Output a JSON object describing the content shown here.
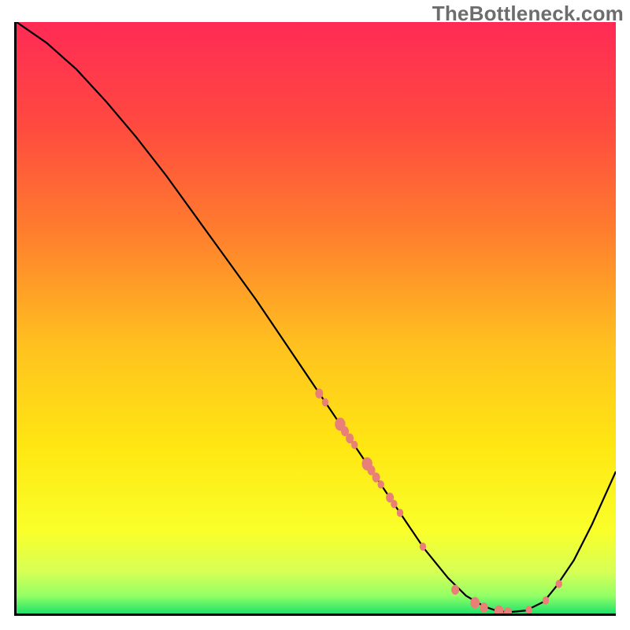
{
  "watermark": "TheBottleneck.com",
  "chart_data": {
    "type": "line",
    "title": "",
    "xlabel": "",
    "ylabel": "",
    "xlim": [
      0,
      100
    ],
    "ylim": [
      0,
      100
    ],
    "grid": false,
    "legend": false,
    "gradient_stops": [
      {
        "offset": 0.0,
        "color": "#ff2a55"
      },
      {
        "offset": 0.18,
        "color": "#ff4b3f"
      },
      {
        "offset": 0.35,
        "color": "#ff7c2e"
      },
      {
        "offset": 0.55,
        "color": "#ffc21f"
      },
      {
        "offset": 0.72,
        "color": "#ffe712"
      },
      {
        "offset": 0.86,
        "color": "#faff2a"
      },
      {
        "offset": 0.93,
        "color": "#d6ff55"
      },
      {
        "offset": 0.97,
        "color": "#93ff66"
      },
      {
        "offset": 1.0,
        "color": "#20e36a"
      }
    ],
    "series": [
      {
        "name": "bottleneck-curve",
        "color": "#000000",
        "x": [
          0,
          5,
          10,
          15,
          20,
          25,
          30,
          35,
          40,
          45,
          50,
          55,
          60,
          62,
          65,
          68,
          70,
          72,
          75,
          78,
          80,
          82,
          85,
          88,
          90,
          93,
          96,
          100
        ],
        "y": [
          100,
          96.5,
          92,
          86.5,
          80.5,
          74,
          67,
          60,
          53,
          45.5,
          38,
          30.5,
          23,
          20,
          15.5,
          11,
          8.5,
          6,
          3,
          1.2,
          0.5,
          0.2,
          0.5,
          2,
          4.5,
          9,
          15,
          24
        ]
      }
    ],
    "scatter_points": {
      "name": "highlighted-points",
      "color": "#e98077",
      "points": [
        {
          "x": 50.5,
          "y": 37.2,
          "r": 6
        },
        {
          "x": 51.5,
          "y": 35.7,
          "r": 5
        },
        {
          "x": 54.0,
          "y": 32.0,
          "r": 8
        },
        {
          "x": 54.8,
          "y": 30.8,
          "r": 6
        },
        {
          "x": 55.6,
          "y": 29.6,
          "r": 6
        },
        {
          "x": 56.4,
          "y": 28.5,
          "r": 5
        },
        {
          "x": 58.5,
          "y": 25.3,
          "r": 8
        },
        {
          "x": 59.2,
          "y": 24.2,
          "r": 6
        },
        {
          "x": 60.0,
          "y": 23.0,
          "r": 6
        },
        {
          "x": 60.8,
          "y": 21.8,
          "r": 5
        },
        {
          "x": 62.3,
          "y": 19.6,
          "r": 6
        },
        {
          "x": 63.0,
          "y": 18.5,
          "r": 5
        },
        {
          "x": 64.0,
          "y": 17.0,
          "r": 5
        },
        {
          "x": 67.8,
          "y": 11.3,
          "r": 5
        },
        {
          "x": 73.2,
          "y": 4.0,
          "r": 6
        },
        {
          "x": 76.5,
          "y": 1.8,
          "r": 7
        },
        {
          "x": 78.0,
          "y": 1.0,
          "r": 6
        },
        {
          "x": 80.5,
          "y": 0.4,
          "r": 7
        },
        {
          "x": 82.0,
          "y": 0.2,
          "r": 6
        },
        {
          "x": 85.5,
          "y": 0.6,
          "r": 5
        },
        {
          "x": 88.3,
          "y": 2.2,
          "r": 5
        },
        {
          "x": 90.5,
          "y": 5.0,
          "r": 5
        }
      ]
    }
  }
}
